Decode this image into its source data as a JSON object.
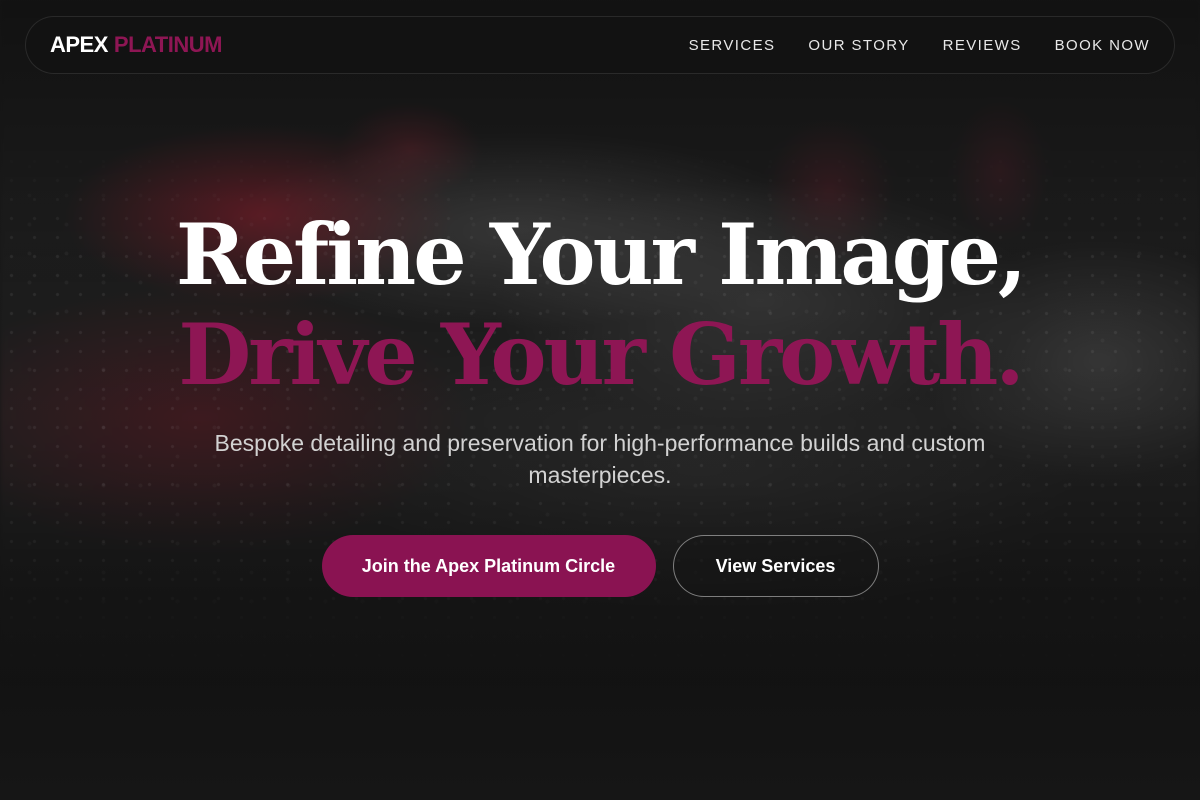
{
  "brand": {
    "name_part1": "APEX",
    "name_part2": "PLATINUM",
    "accent_color": "#8e1654"
  },
  "nav": {
    "items": [
      {
        "label": "SERVICES"
      },
      {
        "label": "OUR STORY"
      },
      {
        "label": "REVIEWS"
      },
      {
        "label": "BOOK NOW"
      }
    ]
  },
  "hero": {
    "headline_line1": "Refine Your Image,",
    "headline_line2": "Drive Your Growth.",
    "subtitle": "Bespoke detailing and preservation for high-performance builds and custom masterpieces.",
    "primary_cta": "Join the Apex Platinum Circle",
    "secondary_cta": "View Services"
  },
  "colors": {
    "background": "#141414",
    "accent": "#8e1654",
    "text_primary": "#ffffff",
    "text_secondary": "#d2d2d2"
  }
}
